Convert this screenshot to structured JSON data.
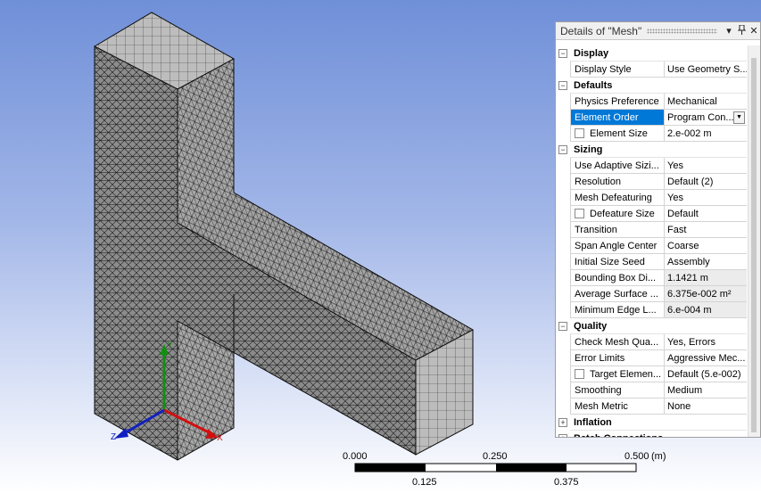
{
  "panel": {
    "title": "Details of \"Mesh\"",
    "buttons": {
      "dropdown": "▾",
      "pin": "📌",
      "close": "✕"
    },
    "sections": [
      {
        "name": "Display",
        "expanded": true,
        "rows": [
          {
            "label": "Display Style",
            "value": "Use Geometry S..."
          }
        ]
      },
      {
        "name": "Defaults",
        "expanded": true,
        "rows": [
          {
            "label": "Physics Preference",
            "value": "Mechanical"
          },
          {
            "label": "Element Order",
            "value": "Program Con...",
            "selected": true,
            "dropdown": true
          },
          {
            "label": "Element Size",
            "value": "2.e-002 m",
            "checkbox": true
          }
        ]
      },
      {
        "name": "Sizing",
        "expanded": true,
        "rows": [
          {
            "label": "Use Adaptive Sizi...",
            "value": "Yes"
          },
          {
            "label": "Resolution",
            "value": "Default (2)"
          },
          {
            "label": "Mesh Defeaturing",
            "value": "Yes"
          },
          {
            "label": "Defeature Size",
            "value": "Default",
            "checkbox": true
          },
          {
            "label": "Transition",
            "value": "Fast"
          },
          {
            "label": "Span Angle Center",
            "value": "Coarse"
          },
          {
            "label": "Initial Size Seed",
            "value": "Assembly"
          },
          {
            "label": "Bounding Box Di...",
            "value": "1.1421 m",
            "readonly": true
          },
          {
            "label": "Average Surface ...",
            "value": "6.375e-002 m²",
            "readonly": true
          },
          {
            "label": "Minimum Edge L...",
            "value": "6.e-004 m",
            "readonly": true
          }
        ]
      },
      {
        "name": "Quality",
        "expanded": true,
        "rows": [
          {
            "label": "Check Mesh Qua...",
            "value": "Yes, Errors"
          },
          {
            "label": "Error Limits",
            "value": "Aggressive Mec..."
          },
          {
            "label": "Target Elemen...",
            "value": "Default (5.e-002)",
            "checkbox": true
          },
          {
            "label": "Smoothing",
            "value": "Medium"
          },
          {
            "label": "Mesh Metric",
            "value": "None"
          }
        ]
      },
      {
        "name": "Inflation",
        "expanded": false,
        "rows": []
      },
      {
        "name": "Batch Connections",
        "expanded": false,
        "rows": []
      }
    ]
  },
  "scale": {
    "top_labels": [
      "0.000",
      "0.250",
      "0.500"
    ],
    "bottom_labels": [
      "0.125",
      "0.375"
    ],
    "unit": "(m)"
  },
  "triad": {
    "x": "X",
    "y": "Y",
    "z": "Z",
    "colors": {
      "x": "#d01010",
      "y": "#109010",
      "z": "#1020c0"
    }
  },
  "colors": {
    "mesh_face": "#9c9c9c",
    "mesh_face_light": "#bdbdbd",
    "mesh_line": "#1a1a1a",
    "selection_blue": "#0078d7"
  }
}
